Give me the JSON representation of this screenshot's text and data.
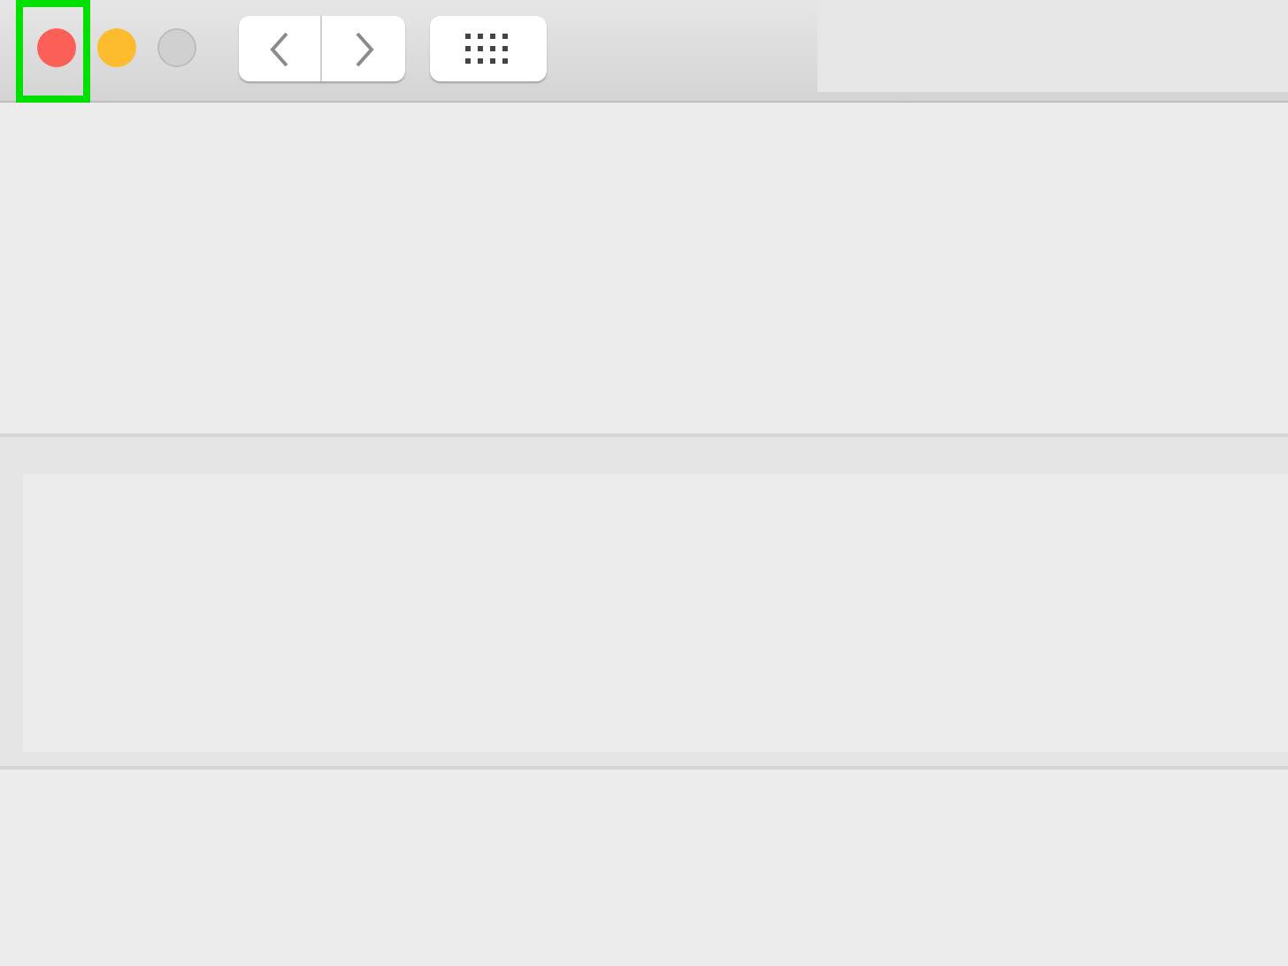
{
  "window": {
    "traffic_lights": [
      {
        "kind": "close",
        "disabled": false,
        "highlighted": true
      },
      {
        "kind": "minimize",
        "disabled": false,
        "highlighted": false
      },
      {
        "kind": "zoom",
        "disabled": true,
        "highlighted": false
      }
    ]
  }
}
